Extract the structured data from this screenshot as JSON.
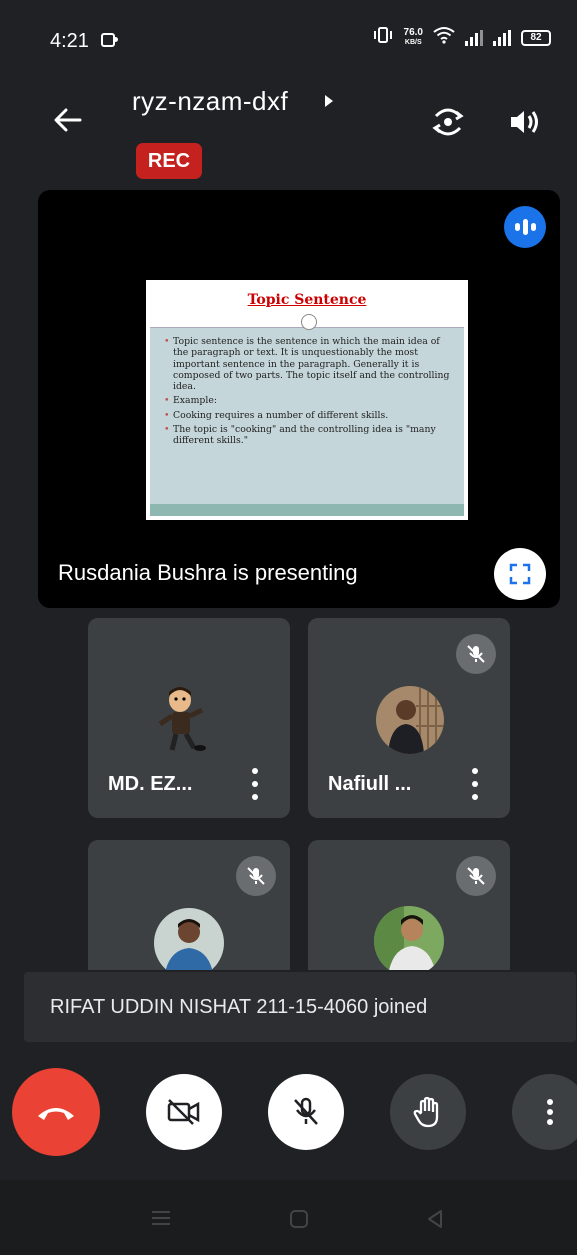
{
  "status_bar": {
    "time": "4:21",
    "net_speed": "76.0",
    "net_unit": "KB/S",
    "battery": "82"
  },
  "header": {
    "meeting_code": "ryz-nzam-dxf",
    "rec_label": "REC"
  },
  "presentation": {
    "presenter_text": "Rusdania Bushra is presenting",
    "slide": {
      "title": "Topic Sentence",
      "bullets": [
        "Topic sentence is the sentence in which the main idea of the paragraph or text. It is unquestionably the most important sentence in the paragraph. Generally it is composed of two parts. The topic itself and the controlling idea.",
        "Example:",
        "Cooking requires a number of different skills.",
        "The topic is \"cooking\" and the controlling idea is \"many different skills.\""
      ]
    }
  },
  "participants": [
    {
      "name": "MD. EZ...",
      "muted": false
    },
    {
      "name": "Nafiull ...",
      "muted": true
    },
    {
      "name": "",
      "muted": true
    },
    {
      "name": "",
      "muted": true
    }
  ],
  "toast": {
    "text": "RIFAT UDDIN NISHAT 211-15-4060 joined"
  },
  "colors": {
    "background": "#202124",
    "tile": "#3c4043",
    "end_call": "#ea4335",
    "rec": "#c5221f",
    "accent": "#1a73e8"
  },
  "icons": [
    "back-arrow-icon",
    "chevron-right-icon",
    "switch-camera-icon",
    "speaker-icon",
    "speaking-indicator-icon",
    "fullscreen-icon",
    "mic-off-icon",
    "more-vert-icon",
    "call-end-icon",
    "camera-off-icon",
    "raise-hand-icon"
  ]
}
